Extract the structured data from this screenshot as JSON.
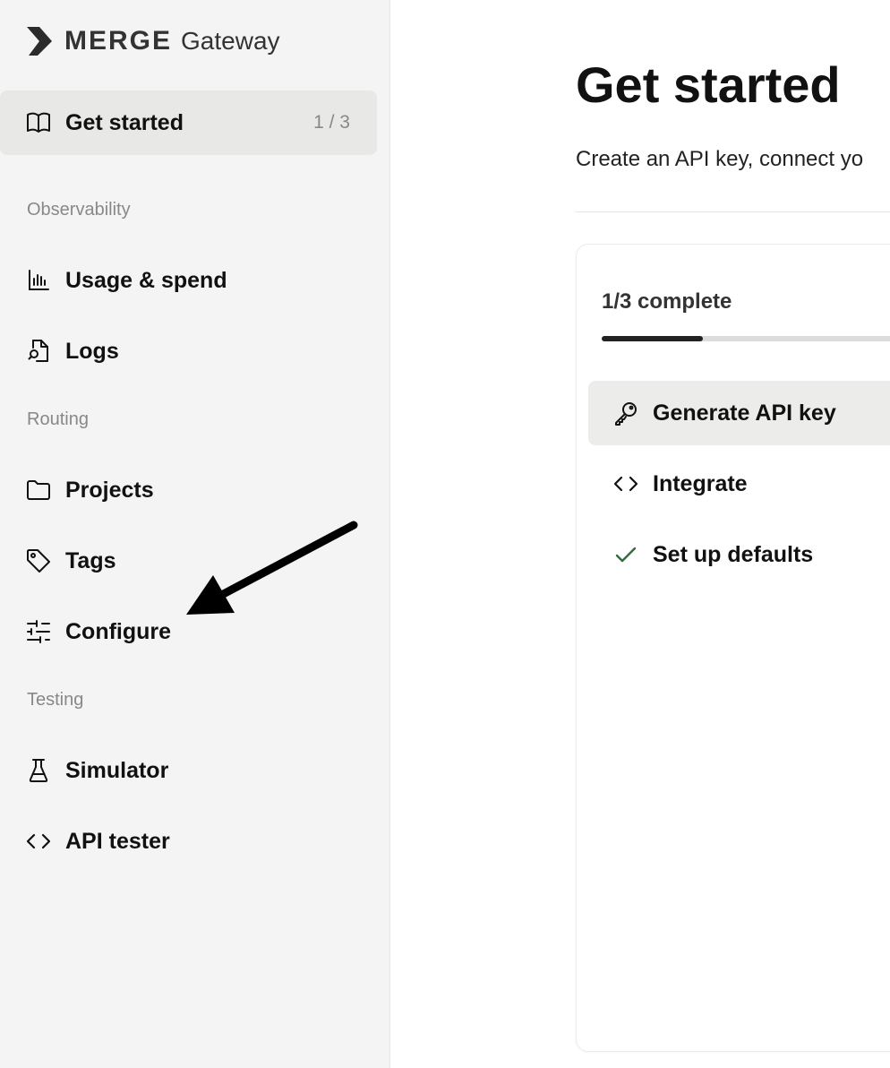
{
  "brand": {
    "name": "MERGE",
    "sub": "Gateway"
  },
  "sidebar": {
    "get_started": {
      "label": "Get started",
      "count": "1 / 3",
      "icon": "book-open-icon"
    },
    "sections": [
      {
        "label": "Observability",
        "items": [
          {
            "label": "Usage & spend",
            "icon": "bar-chart-icon"
          },
          {
            "label": "Logs",
            "icon": "file-search-icon"
          }
        ]
      },
      {
        "label": "Routing",
        "items": [
          {
            "label": "Projects",
            "icon": "folder-icon"
          },
          {
            "label": "Tags",
            "icon": "tag-icon"
          },
          {
            "label": "Configure",
            "icon": "sliders-icon"
          }
        ]
      },
      {
        "label": "Testing",
        "items": [
          {
            "label": "Simulator",
            "icon": "flask-icon"
          },
          {
            "label": "API tester",
            "icon": "code-icon"
          }
        ]
      }
    ]
  },
  "main": {
    "title": "Get started",
    "subtitle": "Create an API key, connect yo",
    "progress": {
      "label": "1/3 complete",
      "completed": 1,
      "total": 3
    },
    "steps": [
      {
        "label": "Generate API key",
        "icon": "key-icon"
      },
      {
        "label": "Integrate",
        "icon": "code-icon"
      },
      {
        "label": "Set up defaults",
        "icon": "check-icon"
      }
    ]
  },
  "colors": {
    "sidebar_bg": "#f4f4f4",
    "active_bg": "#e8e8e6",
    "check_green": "#2f6e3a",
    "text": "#111111",
    "muted": "#888888"
  }
}
